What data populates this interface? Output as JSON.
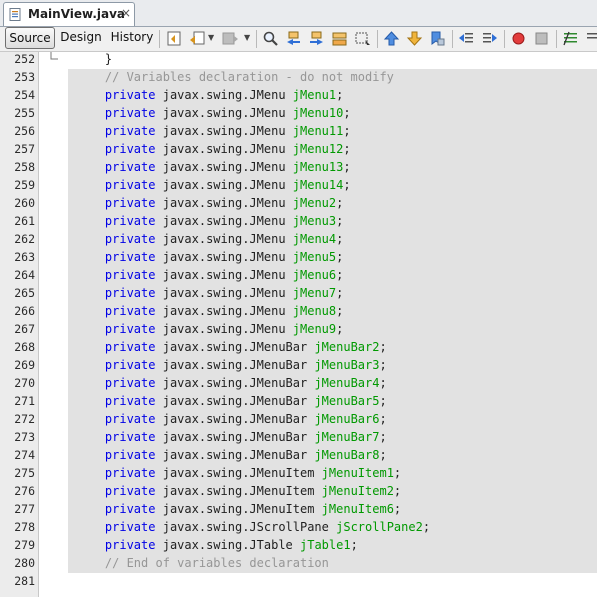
{
  "tab": {
    "title": "MainView.java",
    "close": "×"
  },
  "toolbar": {
    "source": "Source",
    "design": "Design",
    "history": "History"
  },
  "colors": {
    "keyword": "#0000e6",
    "identifier": "#009900",
    "comment": "#969696",
    "guarded_bg": "#e2e2e2"
  },
  "editor": {
    "lines": [
      {
        "n": "252",
        "indent": "    ",
        "text": "}"
      },
      {
        "n": "253",
        "indent": "    ",
        "comment": "// Variables declaration - do not modify"
      },
      {
        "n": "254",
        "indent": "    ",
        "kw": "private",
        "type": "javax.swing.JMenu",
        "id": "jMenu1",
        "end": ";"
      },
      {
        "n": "255",
        "indent": "    ",
        "kw": "private",
        "type": "javax.swing.JMenu",
        "id": "jMenu10",
        "end": ";"
      },
      {
        "n": "256",
        "indent": "    ",
        "kw": "private",
        "type": "javax.swing.JMenu",
        "id": "jMenu11",
        "end": ";"
      },
      {
        "n": "257",
        "indent": "    ",
        "kw": "private",
        "type": "javax.swing.JMenu",
        "id": "jMenu12",
        "end": ";"
      },
      {
        "n": "258",
        "indent": "    ",
        "kw": "private",
        "type": "javax.swing.JMenu",
        "id": "jMenu13",
        "end": ";"
      },
      {
        "n": "259",
        "indent": "    ",
        "kw": "private",
        "type": "javax.swing.JMenu",
        "id": "jMenu14",
        "end": ";"
      },
      {
        "n": "260",
        "indent": "    ",
        "kw": "private",
        "type": "javax.swing.JMenu",
        "id": "jMenu2",
        "end": ";"
      },
      {
        "n": "261",
        "indent": "    ",
        "kw": "private",
        "type": "javax.swing.JMenu",
        "id": "jMenu3",
        "end": ";"
      },
      {
        "n": "262",
        "indent": "    ",
        "kw": "private",
        "type": "javax.swing.JMenu",
        "id": "jMenu4",
        "end": ";"
      },
      {
        "n": "263",
        "indent": "    ",
        "kw": "private",
        "type": "javax.swing.JMenu",
        "id": "jMenu5",
        "end": ";"
      },
      {
        "n": "264",
        "indent": "    ",
        "kw": "private",
        "type": "javax.swing.JMenu",
        "id": "jMenu6",
        "end": ";"
      },
      {
        "n": "265",
        "indent": "    ",
        "kw": "private",
        "type": "javax.swing.JMenu",
        "id": "jMenu7",
        "end": ";"
      },
      {
        "n": "266",
        "indent": "    ",
        "kw": "private",
        "type": "javax.swing.JMenu",
        "id": "jMenu8",
        "end": ";"
      },
      {
        "n": "267",
        "indent": "    ",
        "kw": "private",
        "type": "javax.swing.JMenu",
        "id": "jMenu9",
        "end": ";"
      },
      {
        "n": "268",
        "indent": "    ",
        "kw": "private",
        "type": "javax.swing.JMenuBar",
        "id": "jMenuBar2",
        "end": ";"
      },
      {
        "n": "269",
        "indent": "    ",
        "kw": "private",
        "type": "javax.swing.JMenuBar",
        "id": "jMenuBar3",
        "end": ";"
      },
      {
        "n": "270",
        "indent": "    ",
        "kw": "private",
        "type": "javax.swing.JMenuBar",
        "id": "jMenuBar4",
        "end": ";"
      },
      {
        "n": "271",
        "indent": "    ",
        "kw": "private",
        "type": "javax.swing.JMenuBar",
        "id": "jMenuBar5",
        "end": ";"
      },
      {
        "n": "272",
        "indent": "    ",
        "kw": "private",
        "type": "javax.swing.JMenuBar",
        "id": "jMenuBar6",
        "end": ";"
      },
      {
        "n": "273",
        "indent": "    ",
        "kw": "private",
        "type": "javax.swing.JMenuBar",
        "id": "jMenuBar7",
        "end": ";"
      },
      {
        "n": "274",
        "indent": "    ",
        "kw": "private",
        "type": "javax.swing.JMenuBar",
        "id": "jMenuBar8",
        "end": ";"
      },
      {
        "n": "275",
        "indent": "    ",
        "kw": "private",
        "type": "javax.swing.JMenuItem",
        "id": "jMenuItem1",
        "end": ";"
      },
      {
        "n": "276",
        "indent": "    ",
        "kw": "private",
        "type": "javax.swing.JMenuItem",
        "id": "jMenuItem2",
        "end": ";"
      },
      {
        "n": "277",
        "indent": "    ",
        "kw": "private",
        "type": "javax.swing.JMenuItem",
        "id": "jMenuItem6",
        "end": ";"
      },
      {
        "n": "278",
        "indent": "    ",
        "kw": "private",
        "type": "javax.swing.JScrollPane",
        "id": "jScrollPane2",
        "end": ";"
      },
      {
        "n": "279",
        "indent": "    ",
        "kw": "private",
        "type": "javax.swing.JTable",
        "id": "jTable1",
        "end": ";"
      },
      {
        "n": "280",
        "indent": "    ",
        "comment": "// End of variables declaration"
      },
      {
        "n": "281",
        "indent": "",
        "text": ""
      }
    ]
  }
}
